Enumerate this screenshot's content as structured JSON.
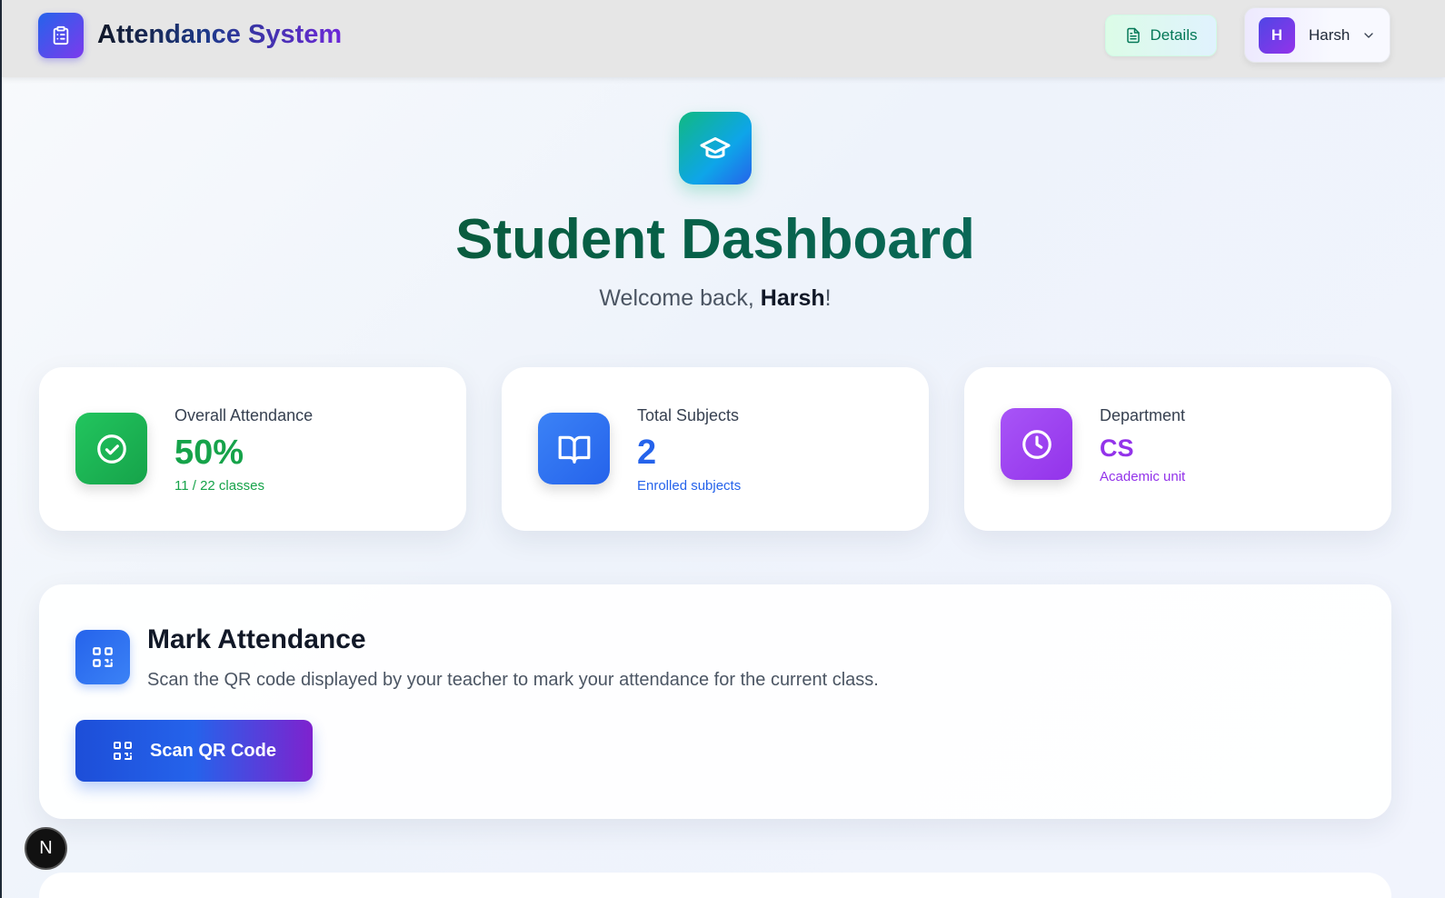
{
  "header": {
    "app_title": "Attendance System",
    "details_label": "Details",
    "user": {
      "initial": "H",
      "name": "Harsh"
    }
  },
  "hero": {
    "title": "Student Dashboard",
    "welcome_prefix": "Welcome back, ",
    "welcome_name": "Harsh",
    "welcome_suffix": "!"
  },
  "stats": [
    {
      "label": "Overall Attendance",
      "value": "50%",
      "sub": "11 / 22 classes",
      "color": "#16a34a",
      "icon": "check-circle-icon"
    },
    {
      "label": "Total Subjects",
      "value": "2",
      "sub": "Enrolled subjects",
      "color": "#2563eb",
      "icon": "book-open-icon"
    },
    {
      "label": "Department",
      "value": "CS",
      "sub": "Academic unit",
      "color": "#9333ea",
      "icon": "clock-icon"
    }
  ],
  "mark_attendance": {
    "title": "Mark Attendance",
    "description": "Scan the QR code displayed by your teacher to mark your attendance for the current class.",
    "button_label": "Scan QR Code"
  },
  "dev_badge": "N"
}
